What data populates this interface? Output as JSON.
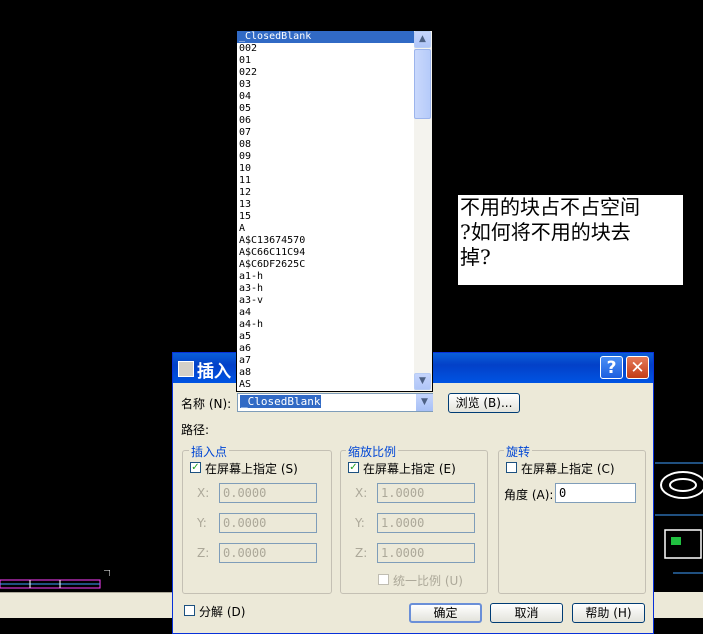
{
  "note": {
    "lines": [
      "不用的块占不占空间",
      "?如何将不用的块去",
      "掉?"
    ]
  },
  "dialog": {
    "title": "插入",
    "help_glyph": "?",
    "close_glyph": "✕",
    "name_label": "名称 (N):",
    "name_value": "_ClosedBlank",
    "browse_label": "浏览 (B)...",
    "path_label": "路径:",
    "insertion": {
      "title": "插入点",
      "specify_label": "在屏幕上指定 (S)",
      "specify_checked": true,
      "x_label": "X:",
      "x_value": "0.0000",
      "y_label": "Y:",
      "y_value": "0.0000",
      "z_label": "Z:",
      "z_value": "0.0000"
    },
    "scale": {
      "title": "缩放比例",
      "specify_label": "在屏幕上指定 (E)",
      "specify_checked": true,
      "x_label": "X:",
      "x_value": "1.0000",
      "y_label": "Y:",
      "y_value": "1.0000",
      "z_label": "Z:",
      "z_value": "1.0000",
      "uniform_label": "统一比例 (U)"
    },
    "rotation": {
      "title": "旋转",
      "specify_label": "在屏幕上指定 (C)",
      "specify_checked": false,
      "angle_label": "角度 (A):",
      "angle_value": "0"
    },
    "explode_label": "分解 (D)",
    "ok_label": "确定",
    "cancel_label": "取消",
    "help_label": "帮助 (H)"
  },
  "dropdown": {
    "items": [
      "_ClosedBlank",
      "002",
      "01",
      "022",
      "03",
      "04",
      "05",
      "06",
      "07",
      "08",
      "09",
      "10",
      "11",
      "12",
      "13",
      "15",
      "A",
      "A$C13674570",
      "A$C66C11C94",
      "A$C6DF2625C",
      "a1-h",
      "a3-h",
      "a3-v",
      "a4",
      "a4-h",
      "a5",
      "a6",
      "a7",
      "a8",
      "AS"
    ],
    "selected_index": 0
  }
}
